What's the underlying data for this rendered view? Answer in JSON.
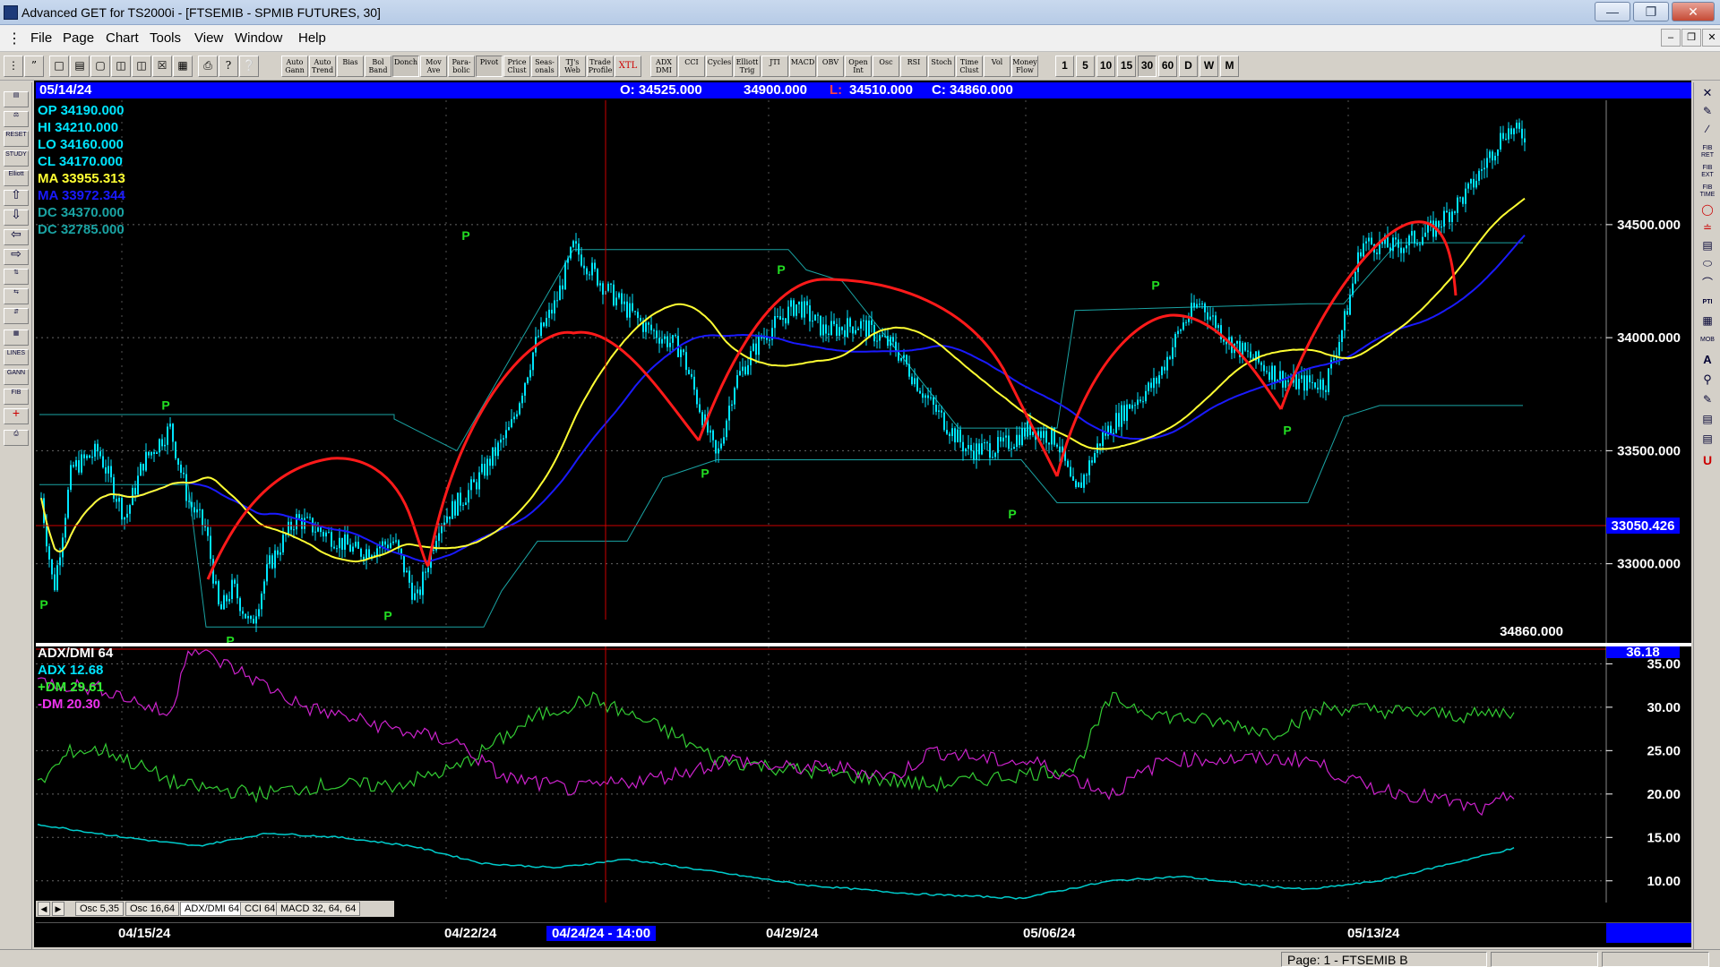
{
  "window": {
    "title": "Advanced GET for TS2000i - [FTSEMIB - SPMIB FUTURES, 30]"
  },
  "menu": [
    "File",
    "Page",
    "Chart",
    "Tools",
    "View",
    "Window",
    "Help"
  ],
  "toolbar": {
    "study_buttons": [
      "Auto Gann",
      "Auto Trend",
      "Bias",
      "Bol Band",
      "Donch",
      "Mov Ave",
      "Para- bolic",
      "Pivot",
      "Price Clust",
      "Seas- onals",
      "TJ's Web",
      "Trade Profile",
      "XTL",
      "ADX DMI",
      "CCI",
      "Cycles",
      "Elliott Trig",
      "JTI",
      "MACD",
      "OBV",
      "Open Int",
      "Osc",
      "RSI",
      "Stoch",
      "Time Clust",
      "Vol",
      "Money Flow"
    ],
    "intervals": [
      "1",
      "5",
      "10",
      "15",
      "30",
      "60",
      "D",
      "W",
      "M"
    ],
    "selected_interval": "30"
  },
  "left_tools": [
    "RESET",
    "STUDY",
    "Elliott",
    "LINES",
    "GANN",
    "FIB"
  ],
  "right_tools": [
    "FIB RET",
    "FIB EXT",
    "FIB TIME",
    "PTI",
    "MOB"
  ],
  "header": {
    "date": "05/14/24",
    "open": "O: 34525.000",
    "high": "34900.000",
    "low_prefix": "L:",
    "low": "34510.000",
    "close": "C: 34860.000"
  },
  "readout": {
    "op": "OP  34190.000",
    "hi": "HI    34210.000",
    "lo": "LO   34160.000",
    "cl": "CL   34170.000",
    "ma1": "MA  33955.313",
    "ma2": "MA  33972.344",
    "dc1": "DC  34370.000",
    "dc2": "DC  32785.000"
  },
  "colors": {
    "candles": "#00e5ff",
    "ma_fast": "#ffff33",
    "ma_slow": "#1a1aff",
    "donchian": "#1aa3a3",
    "cycle": "#ff1a1a",
    "pivot": "#22dd22",
    "adx": "#00cccc",
    "plus_dm": "#33cc33",
    "minus_dm": "#cc22cc",
    "cursor": "#cc0000"
  },
  "price_axis": {
    "ticks": [
      "34500.000",
      "34000.000",
      "33500.000",
      "33000.000"
    ],
    "cursor_price": "33050.426",
    "last_close": "34860.000"
  },
  "indicator": {
    "title": "ADX/DMI 64",
    "adx": "ADX 12.68",
    "plus_dm": "+DM 29.61",
    "minus_dm": "-DM  20.30",
    "cursor_value": "36.18",
    "ticks": [
      "35.00",
      "30.00",
      "25.00",
      "20.00",
      "15.00",
      "10.00"
    ]
  },
  "tabs": [
    "Osc 5,35",
    "Osc 16,64",
    "ADX/DMI 64",
    "CCI 64",
    "MACD 32, 64, 64"
  ],
  "selected_tab": "ADX/DMI 64",
  "time_axis": [
    "04/15/24",
    "04/22/24",
    "04/24/24 - 14:00",
    "04/29/24",
    "05/06/24",
    "05/13/24"
  ],
  "pivot_label": "P",
  "status": {
    "page": "Page: 1 - FTSEMIB B"
  },
  "chart_data": {
    "type": "candlestick",
    "interval": "30 min",
    "price_range": [
      32650,
      35050
    ],
    "indicator_range": [
      7.5,
      37
    ],
    "pivots_high": [
      {
        "date": "04/12/24",
        "price": 33650
      },
      {
        "date": "04/23/24",
        "price": 34400
      },
      {
        "date": "04/29/24",
        "price": 34250
      },
      {
        "date": "05/08/24",
        "price": 34180
      }
    ],
    "pivots_low": [
      {
        "date": "04/11/24",
        "price": 32880
      },
      {
        "date": "04/15/24",
        "price": 32720
      },
      {
        "date": "04/19/24",
        "price": 32830
      },
      {
        "date": "04/26/24",
        "price": 33460
      },
      {
        "date": "05/06/24",
        "price": 33280
      },
      {
        "date": "05/10/24",
        "price": 33650
      }
    ],
    "series": [
      {
        "name": "ADX",
        "last": 12.68
      },
      {
        "name": "+DM",
        "last": 29.61
      },
      {
        "name": "-DM",
        "last": 20.3
      }
    ]
  }
}
